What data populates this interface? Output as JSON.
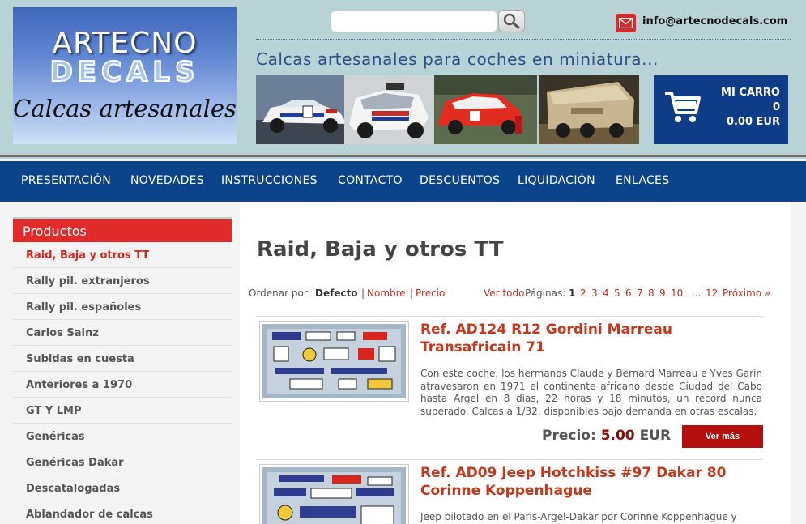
{
  "header": {
    "logo": {
      "line1": "ARTECNO",
      "line2": "DECALS",
      "line3": "Calcas artesanales"
    },
    "search": {
      "placeholder": "",
      "button_icon": "search-icon"
    },
    "email_icon": "mail-icon",
    "email": "info@artecnodecals.com",
    "tagline": "Calcas artesanales para coches en miniatura...",
    "photos": [
      "rally-car-photo",
      "raid-truck-photo",
      "red-rally-car-photo",
      "raid-truck-desert-photo"
    ]
  },
  "cart": {
    "icon": "cart-icon",
    "title": "MI CARRO",
    "count": "0",
    "total": "0.00 EUR"
  },
  "nav": {
    "items": [
      "PRESENTACIÓN",
      "NOVEDADES",
      "INSTRUCCIONES",
      "CONTACTO",
      "DESCUENTOS",
      "LIQUIDACIÓN",
      "ENLACES"
    ]
  },
  "sidebar": {
    "title": "Productos",
    "items": [
      "Raid, Baja y otros TT",
      "Rally pil. extranjeros",
      "Rally pil. españoles",
      "Carlos Sainz",
      "Subidas en cuesta",
      "Anteriores a 1970",
      "GT Y LMP",
      "Genéricas",
      "Genéricas Dakar",
      "Descatalogadas",
      "Ablandador de calcas"
    ],
    "active_index": 0
  },
  "main": {
    "title": "Raid, Baja y otros TT",
    "sort": {
      "label": "Ordenar por:",
      "options": [
        "Defecto",
        "Nombre",
        "Precio"
      ],
      "view_all": "Ver todo",
      "pages_label": "Páginas:",
      "pages": [
        "1",
        "2",
        "3",
        "4",
        "5",
        "6",
        "7",
        "8",
        "9",
        "10"
      ],
      "ellipsis": "...",
      "last_page": "12",
      "next": "Próximo »"
    },
    "products": [
      {
        "title": "Ref. AD124 R12 Gordini Marreau Transafricain 71",
        "description": "Con este coche, los hermanos Claude y Bernard Marreau e Yves Garin atravesaron en 1971 el continente africano desde Ciudad del Cabo hasta Argel en 8 días, 22 horas y 18 minutos, un récord nunca superado. Calcas a 1/32, disponibles bajo demanda en otras escalas.",
        "price_label": "Precio:",
        "price": "5.00",
        "currency": "EUR",
        "button": "Ver más"
      },
      {
        "title": "Ref. AD09 Jeep Hotchkiss #97 Dakar 80 Corinne Koppenhague",
        "description": "Jeep pilotado en el Paris-Argel-Dakar por Corinne Koppenhague y"
      }
    ]
  },
  "colors": {
    "header_bg": "#b9d2d6",
    "nav_bg": "#0b4488",
    "cart_bg": "#0f3c86",
    "accent_red": "#e12b2b",
    "link_red": "#c0311f",
    "title_red": "#c8361a",
    "button_red": "#b30f0f"
  }
}
